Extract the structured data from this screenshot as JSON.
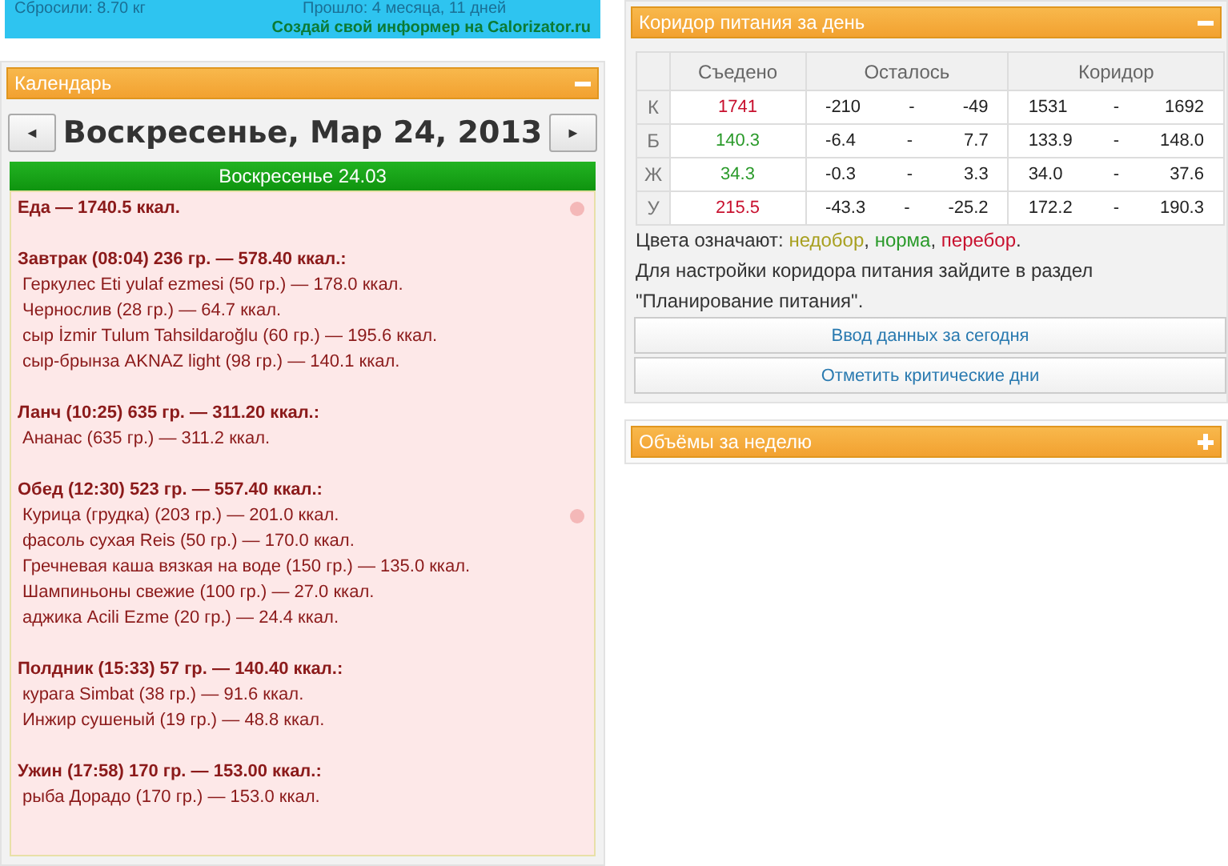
{
  "banner": {
    "lost": "Сбросили: 8.70 кг",
    "elapsed": "Прошло: 4 месяца, 11 дней",
    "link": "Создай свой информер на Calorizator.ru"
  },
  "calendar": {
    "title": "Календарь",
    "expanded": true,
    "prev": "◄",
    "next": "►",
    "date": "Воскресенье, Мар 24, 2013",
    "day_header": "Воскресенье 24.03",
    "total": "Еда — 1740.5 ккал.",
    "meals": [
      {
        "title": "Завтрак (08:04) 236 гр. — 578.40 ккал.:",
        "items": [
          "Геркулес Eti yulaf ezmesi (50 гр.) — 178.0 ккал.",
          "Чернослив (28 гр.) — 64.7 ккал.",
          "сыр İzmir Tulum Tahsildaroğlu (60 гр.) — 195.6 ккал.",
          "сыр-брынза AKNAZ light (98 гр.) — 140.1 ккал."
        ]
      },
      {
        "title": "Ланч (10:25) 635 гр. — 311.20 ккал.:",
        "items": [
          "Ананас (635 гр.) — 311.2 ккал."
        ]
      },
      {
        "title": "Обед (12:30) 523 гр. — 557.40 ккал.:",
        "items": [
          "Курица (грудка) (203 гр.) — 201.0 ккал.",
          "фасоль сухая Reis (50 гр.) — 170.0 ккал.",
          "Гречневая каша вязкая на воде (150 гр.) — 135.0 ккал.",
          "Шампиньоны свежие (100 гр.) — 27.0 ккал.",
          "аджика Acili Ezme (20 гр.) — 24.4 ккал."
        ]
      },
      {
        "title": "Полдник (15:33) 57 гр. — 140.40 ккал.:",
        "items": [
          "курага Simbat (38 гр.) — 91.6 ккал.",
          "Инжир сушеный (19 гр.) — 48.8 ккал."
        ]
      },
      {
        "title": "Ужин (17:58) 170 гр. — 153.00 ккал.:",
        "items": [
          "рыба Дорадо (170 гр.) — 153.0 ккал."
        ]
      }
    ]
  },
  "corridor": {
    "title": "Коридор питания за день",
    "expanded": true,
    "columns": [
      "Съедено",
      "Осталось",
      "Коридор"
    ],
    "rows": [
      {
        "label": "К",
        "eaten": "1741",
        "color": "#c8102e",
        "left_from": "-210",
        "left_to": "-49",
        "range_from": "1531",
        "range_to": "1692"
      },
      {
        "label": "Б",
        "eaten": "140.3",
        "color": "#2a9a2a",
        "left_from": "-6.4",
        "left_to": "7.7",
        "range_from": "133.9",
        "range_to": "148.0"
      },
      {
        "label": "Ж",
        "eaten": "34.3",
        "color": "#2a9a2a",
        "left_from": "-0.3",
        "left_to": "3.3",
        "range_from": "34.0",
        "range_to": "37.6"
      },
      {
        "label": "У",
        "eaten": "215.5",
        "color": "#c8102e",
        "left_from": "-43.3",
        "left_to": "-25.2",
        "range_from": "172.2",
        "range_to": "190.3"
      }
    ],
    "separator": "-",
    "legend_label": "Цвета означают:",
    "legend": [
      {
        "text": "недобор",
        "color": "#a8a020",
        "after": ","
      },
      {
        "text": "норма",
        "color": "#2a9a2a",
        "after": ","
      },
      {
        "text": "перебор",
        "color": "#c8102e",
        "after": "."
      }
    ],
    "note": "Для настройки коридора питания зайдите в раздел \"Планирование питания\".",
    "buttons": [
      "Ввод данных за сегодня",
      "Отметить критические дни"
    ]
  },
  "weekly": {
    "title": "Объёмы за неделю",
    "expanded": false
  }
}
